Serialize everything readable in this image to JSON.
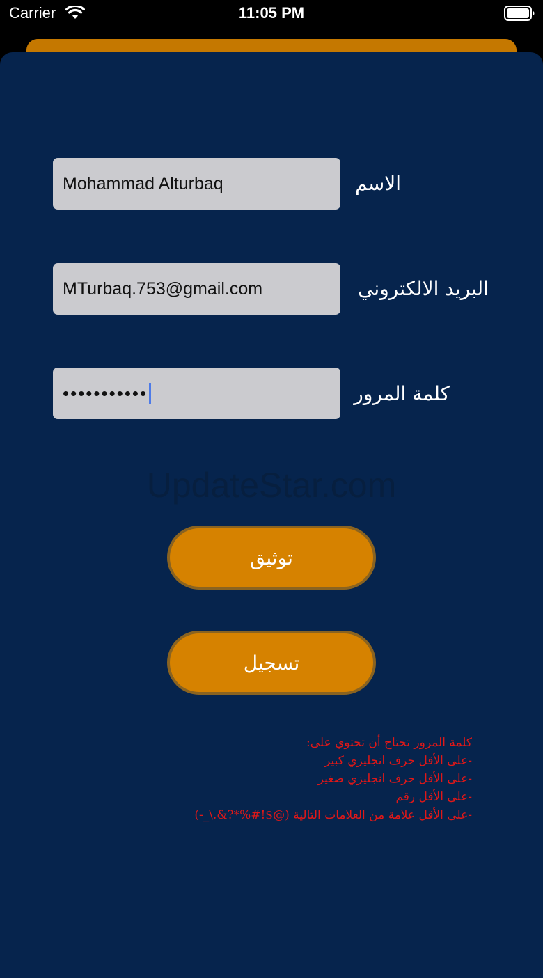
{
  "status_bar": {
    "carrier": "Carrier",
    "time": "11:05 PM",
    "wifi_icon": "wifi-icon",
    "battery_icon": "battery-icon"
  },
  "colors": {
    "background": "#06244d",
    "accent": "#d68200",
    "field_background": "#cbcbcf",
    "rules_text": "#e01818"
  },
  "form": {
    "name": {
      "label": "الاسم",
      "value": "Mohammad Alturbaq"
    },
    "email": {
      "label": "البريد الالكتروني",
      "value": "MTurbaq.753@gmail.com"
    },
    "password": {
      "label": "كلمة المرور",
      "value": "•••••••••••"
    }
  },
  "watermark": "UpdateStar.com",
  "buttons": {
    "verify": "توثيق",
    "register": "تسجيل"
  },
  "password_rules": {
    "heading": "كلمة المرور تحتاج أن تحتوي على:",
    "items": [
      "-على الأقل حرف انجليزي كبير",
      "-على الأقل حرف انجليزي صغير",
      "-على الأقل رقم",
      "-على الأقل علامة من العلامات التالية (@$!#%*?&.\\_-)"
    ]
  }
}
